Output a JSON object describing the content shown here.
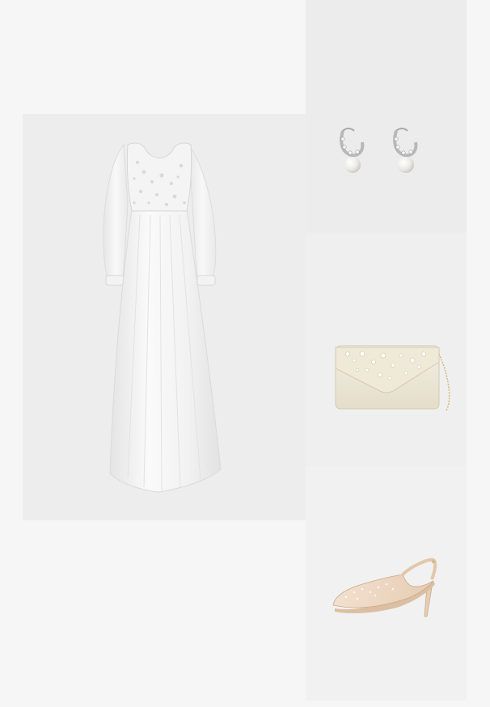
{
  "collage": {
    "background": "#f6f6f6",
    "items": [
      {
        "name": "dress",
        "tile_color": "#ededed"
      },
      {
        "name": "earrings",
        "tile_color": "#ececec"
      },
      {
        "name": "clutch",
        "tile_color": "#efefef"
      },
      {
        "name": "shoe",
        "tile_color": "#f1f1f1"
      }
    ]
  }
}
